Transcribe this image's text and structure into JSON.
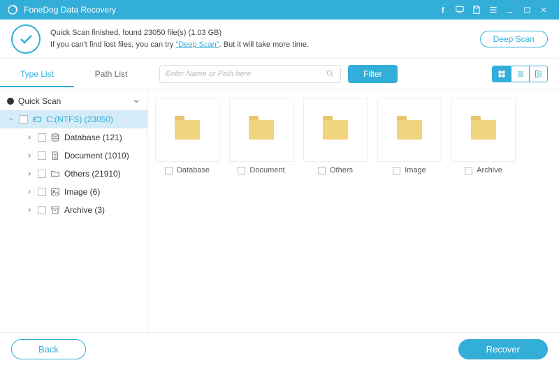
{
  "app": {
    "title": "FoneDog Data Recovery"
  },
  "status": {
    "line1": "Quick Scan finished, found 23050 file(s) (1.03 GB)",
    "line2_pre": "If you can't find lost files, you can try ",
    "deep_link": "\"Deep Scan\"",
    "line2_post": ". But it will take more time.",
    "deep_button": "Deep Scan"
  },
  "toolbar": {
    "tabs": {
      "type": "Type List",
      "path": "Path List"
    },
    "search_placeholder": "Enter Name or Path here",
    "filter": "Filter"
  },
  "sidebar": {
    "top": "Quick Scan",
    "drive": "C:(NTFS) (23050)",
    "items": [
      {
        "label": "Database (121)"
      },
      {
        "label": "Document (1010)"
      },
      {
        "label": "Others (21910)"
      },
      {
        "label": "Image (6)"
      },
      {
        "label": "Archive (3)"
      }
    ]
  },
  "grid": [
    {
      "label": "Database"
    },
    {
      "label": "Document"
    },
    {
      "label": "Others"
    },
    {
      "label": "Image"
    },
    {
      "label": "Archive"
    }
  ],
  "buttons": {
    "back": "Back",
    "recover": "Recover"
  }
}
